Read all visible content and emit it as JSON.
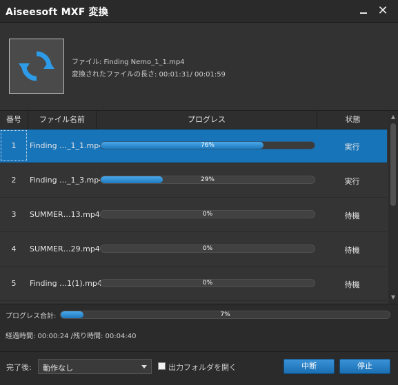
{
  "window": {
    "title": "Aiseesoft MXF 変換",
    "minimize_icon": "minimize-icon",
    "close_icon": "close-icon",
    "close_glyph": "✕"
  },
  "info": {
    "file_line": "ファイル: Finding Nemo_1_1.mp4",
    "length_line": "変換されたファイルの長さ: 00:01:31/ 00:01:59",
    "thumbnail_icon": "convert-refresh-icon"
  },
  "table": {
    "headers": {
      "num": "番号",
      "filename": "ファイル名前",
      "progress": "プログレス",
      "status": "状態"
    },
    "rows": [
      {
        "num": "1",
        "filename": "Finding …_1_1.mp4",
        "progress": 76,
        "progress_text": "76%",
        "status": "実行",
        "selected": true
      },
      {
        "num": "2",
        "filename": "Finding …_1_3.mp4",
        "progress": 29,
        "progress_text": "29%",
        "status": "実行",
        "selected": false
      },
      {
        "num": "3",
        "filename": "SUMMER…13.mp4",
        "progress": 0,
        "progress_text": "0%",
        "status": "待機",
        "selected": false
      },
      {
        "num": "4",
        "filename": "SUMMER…29.mp4",
        "progress": 0,
        "progress_text": "0%",
        "status": "待機",
        "selected": false
      },
      {
        "num": "5",
        "filename": "Finding …1(1).mp4",
        "progress": 0,
        "progress_text": "0%",
        "status": "待機",
        "selected": false
      }
    ]
  },
  "total": {
    "label": "プログレス合計:",
    "progress": 7,
    "progress_text": "7%",
    "time_text": "経過時間: 00:00:24 /残り時間: 00:04:40"
  },
  "footer": {
    "after_label": "完了後:",
    "after_value": "動作なし",
    "open_folder_label": "出力フォルダを開く",
    "open_folder_checked": false,
    "abort_label": "中断",
    "stop_label": "停止"
  },
  "colors": {
    "accent": "#1874b8",
    "fill": "#2a8ad6",
    "background": "#2b2b2b"
  }
}
